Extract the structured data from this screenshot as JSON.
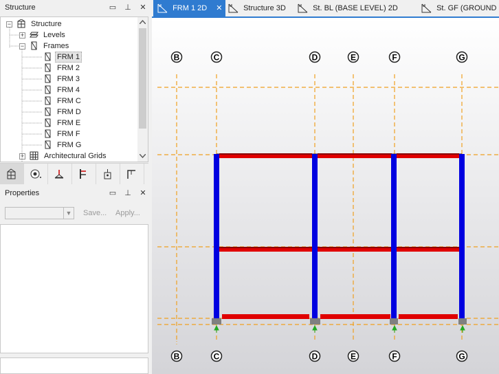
{
  "structure_panel": {
    "title": "Structure",
    "tree": [
      {
        "label": "Structure",
        "expander": "−",
        "icon": "structure-icon"
      },
      {
        "label": "Levels",
        "expander": "+",
        "icon": "levels-icon"
      },
      {
        "label": "Frames",
        "expander": "−",
        "icon": "frames-icon"
      },
      {
        "label": "FRM 1",
        "icon": "frame-icon",
        "selected": true
      },
      {
        "label": "FRM 2",
        "icon": "frame-icon"
      },
      {
        "label": "FRM 3",
        "icon": "frame-icon"
      },
      {
        "label": "FRM 4",
        "icon": "frame-icon"
      },
      {
        "label": "FRM C",
        "icon": "frame-icon"
      },
      {
        "label": "FRM D",
        "icon": "frame-icon"
      },
      {
        "label": "FRM E",
        "icon": "frame-icon"
      },
      {
        "label": "FRM F",
        "icon": "frame-icon"
      },
      {
        "label": "FRM G",
        "icon": "frame-icon"
      },
      {
        "label": "Architectural Grids",
        "expander": "+",
        "icon": "grid-icon"
      }
    ]
  },
  "properties_panel": {
    "title": "Properties",
    "save_label": "Save...",
    "apply_label": "Apply..."
  },
  "title_buttons": {
    "window": "▭",
    "pin": "⊥",
    "close": "✕"
  },
  "tabs": [
    {
      "label": "FRM 1 2D",
      "active": true,
      "close": "✕"
    },
    {
      "label": "Structure 3D"
    },
    {
      "label": "St. BL (BASE LEVEL) 2D"
    },
    {
      "label": "St. GF (GROUND FLO"
    }
  ],
  "grid_labels": [
    "B",
    "C",
    "D",
    "E",
    "F",
    "G"
  ],
  "colors": {
    "accent": "#2f7bd0",
    "column": "#0000e0",
    "beam": "#e00000",
    "gridline": "#f0a020",
    "support": "#808080",
    "support_arrow": "#22aa22"
  }
}
